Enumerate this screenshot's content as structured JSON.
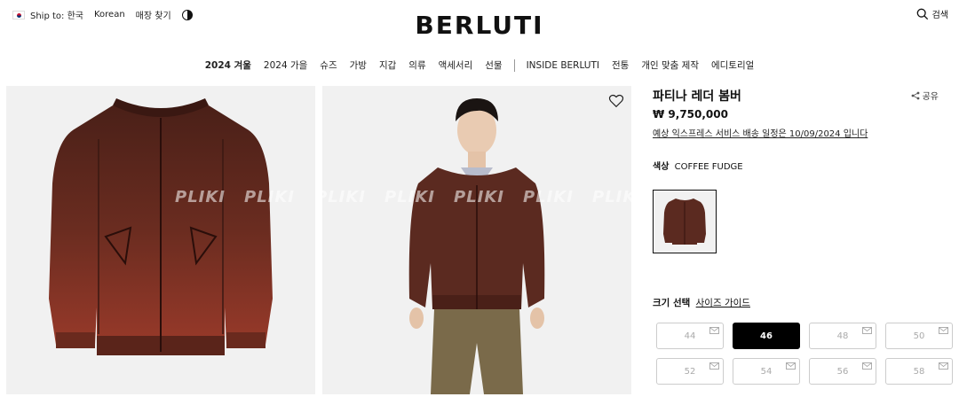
{
  "utility": {
    "ship_to": "Ship to: 한국",
    "language": "Korean",
    "store_finder": "매장 찾기"
  },
  "brand": {
    "logo": "BERLUTI"
  },
  "search": {
    "label": "검색"
  },
  "nav": {
    "items": [
      "2024 겨울",
      "2024 가을",
      "슈즈",
      "가방",
      "지갑",
      "의류",
      "액세서리",
      "선물"
    ],
    "items_after_sep": [
      "INSIDE BERLUTI",
      "전통",
      "개인 맞춤 제작",
      "에디토리얼"
    ]
  },
  "gallery": {
    "watermark": "PLIKI"
  },
  "product": {
    "title": "파티나 레더 봄버",
    "share": "공유",
    "price": "₩ 9,750,000",
    "delivery_note": "예상 익스프레스 서비스 배송 일정은 10/09/2024 입니다",
    "color_label": "색상",
    "color_value": "COFFEE FUDGE",
    "size_label": "크기 선택",
    "size_guide": "사이즈 가이드",
    "sizes": [
      "44",
      "46",
      "48",
      "50",
      "52",
      "54",
      "56",
      "58"
    ],
    "selected_size": "46"
  },
  "colors": {
    "jacket": "#5b2a20",
    "trousers": "#7a6a4a",
    "selected": "#000000"
  }
}
